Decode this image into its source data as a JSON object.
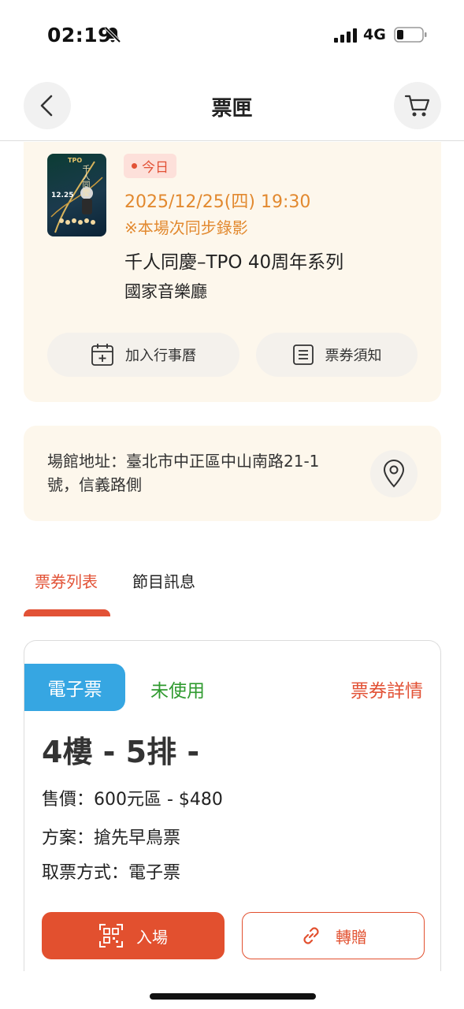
{
  "status_bar": {
    "time": "02:19",
    "network": "4G",
    "icons": [
      "bell-slash-icon",
      "signal-icon",
      "battery-icon"
    ]
  },
  "header": {
    "title": "票匣",
    "icons": [
      "chevron-left-icon",
      "cart-icon"
    ]
  },
  "event": {
    "badge": "今日",
    "datetime": "2025/12/25(四) 19:30",
    "recording_note": "※本場次同步錄影",
    "title": "千人同慶–TPO 40周年系列",
    "venue": "國家音樂廳",
    "poster": {
      "brand": "TPO",
      "title_text": "千人同慶",
      "date_text": "12.25"
    },
    "actions": {
      "add_calendar": "加入行事曆",
      "ticket_notice": "票券須知"
    }
  },
  "address": {
    "text": "場館地址：臺北市中正區中山南路21-1號，信義路側",
    "icon": "map-pin-icon"
  },
  "tabs": [
    {
      "label": "票券列表",
      "active": true
    },
    {
      "label": "節目訊息",
      "active": false
    }
  ],
  "ticket": {
    "type_badge": "電子票",
    "status": "未使用",
    "detail_link": "票券詳情",
    "seat": "4樓 - 5排 -",
    "price": "售價：600元區 - $480",
    "plan": "方案：搶先早鳥票",
    "pickup": "取票方式：電子票",
    "enter_label": "入場",
    "transfer_label": "轉贈"
  },
  "colors": {
    "accent": "#e25236",
    "date_orange": "#e2892f",
    "eticket_blue": "#36a6e2",
    "unused_green": "#2f9a2f",
    "card_bg": "#fdf7ec"
  }
}
